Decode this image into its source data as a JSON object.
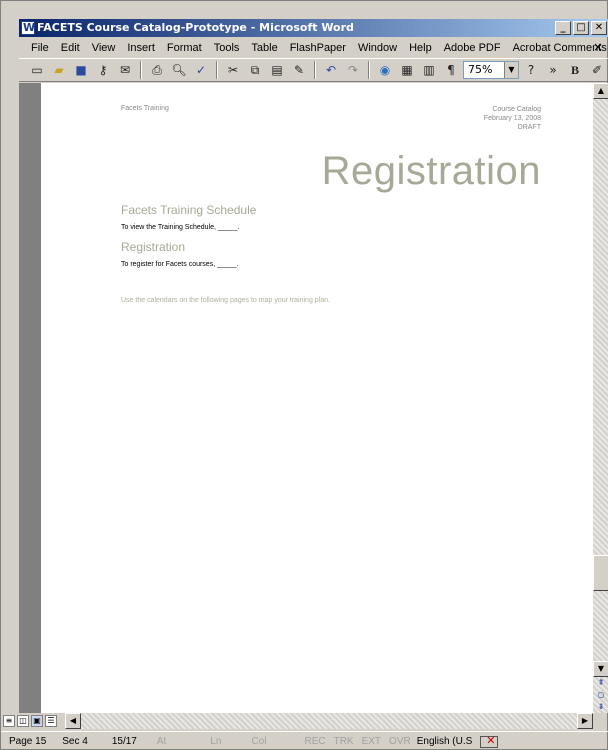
{
  "window": {
    "title": "FACETS Course Catalog-Prototype - Microsoft Word",
    "buttons": [
      "_",
      "□",
      "✕"
    ]
  },
  "menu": {
    "items": [
      "File",
      "Edit",
      "View",
      "Insert",
      "Format",
      "Tools",
      "Table",
      "FlashPaper",
      "Window",
      "Help",
      "Adobe PDF",
      "Acrobat Comments"
    ],
    "close": "×"
  },
  "toolbar": {
    "zoom": "75%",
    "icons": [
      "new-icon",
      "open-icon",
      "save-icon",
      "permission-icon",
      "email-icon",
      "print-icon",
      "print-preview-icon",
      "spelling-icon",
      "cut-icon",
      "copy-icon",
      "paste-icon",
      "format-painter-icon",
      "undo-icon",
      "redo-icon",
      "insert-hyperlink-icon",
      "tables-icon",
      "columns-icon",
      "show-hide-icon"
    ],
    "bold": "B"
  },
  "document": {
    "header_left": "Facets Training",
    "header_right_1": "Course Catalog",
    "header_right_2": "February 13, 2008",
    "header_right_3": "DRAFT",
    "title": "Registration",
    "section1_heading": "Facets Training Schedule",
    "section1_text": "To view the Training Schedule, _____.",
    "section2_heading": "Registration",
    "section2_text": "To register for Facets courses, _____.",
    "note": "Use the calendars on the following pages to map your training plan."
  },
  "status": {
    "page": "Page 15",
    "sec": "Sec 4",
    "pages": "15/17",
    "at": "At",
    "ln": "Ln",
    "col": "Col",
    "rec": "REC",
    "trk": "TRK",
    "ext": "EXT",
    "ovr": "OVR",
    "language": "English (U.S"
  }
}
